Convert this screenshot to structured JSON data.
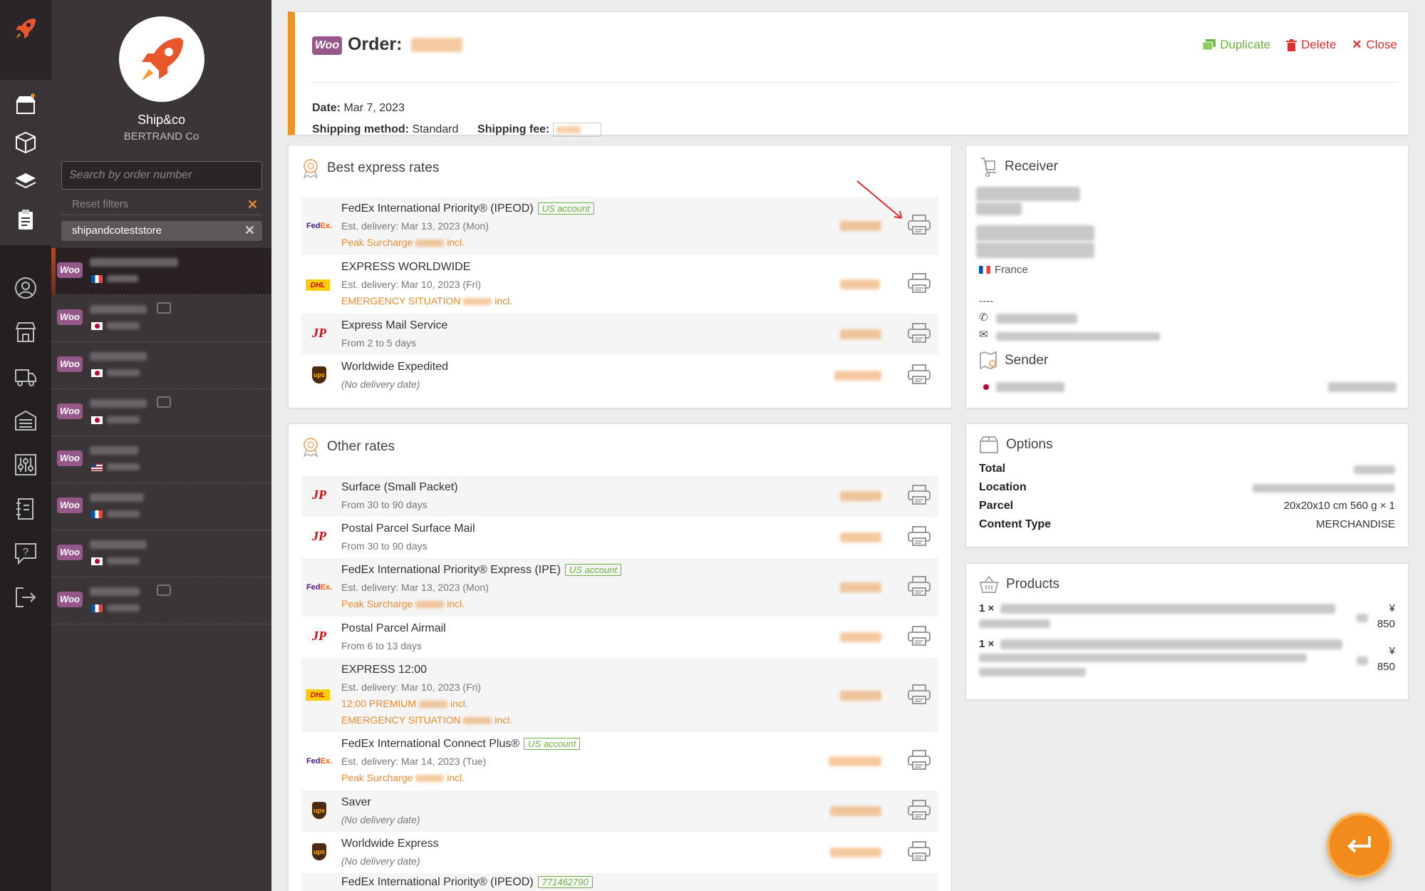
{
  "brand": {
    "name": "Ship&co",
    "company": "BERTRAND Co"
  },
  "sidebar": {
    "search_placeholder": "Search by order number",
    "reset_filters": "Reset filters",
    "filter_chip": "shipandcoteststore",
    "orders": [
      {
        "badge": "Woo",
        "flag": "fr",
        "active": true
      },
      {
        "badge": "Woo",
        "flag": "jp",
        "comment": true
      },
      {
        "badge": "Woo",
        "flag": "jp"
      },
      {
        "badge": "Woo",
        "flag": "jp",
        "comment": true
      },
      {
        "badge": "Woo",
        "flag": "us"
      },
      {
        "badge": "Woo",
        "flag": "fr"
      },
      {
        "badge": "Woo",
        "flag": "jp"
      },
      {
        "badge": "Woo",
        "flag": "fr",
        "comment": true
      }
    ]
  },
  "order": {
    "woo": "Woo",
    "title": "Order:",
    "date_label": "Date:",
    "date_value": "Mar 7, 2023",
    "method_label": "Shipping method:",
    "method_value": "Standard",
    "fee_label": "Shipping fee:",
    "actions": {
      "duplicate": "Duplicate",
      "delete": "Delete",
      "close": "Close"
    }
  },
  "best_rates": {
    "title": "Best express rates",
    "rows": [
      {
        "carrier": "fedex",
        "name": "FedEx International Priority® (IPEOD)",
        "badge": "US account",
        "sub": "Est. delivery: Mar 13, 2023 (Mon)",
        "warn": [
          "Peak Surcharge",
          "incl."
        ]
      },
      {
        "carrier": "dhl",
        "name": "EXPRESS WORLDWIDE",
        "sub": "Est. delivery: Mar 10, 2023 (Fri)",
        "warn": [
          "EMERGENCY SITUATION",
          "incl."
        ]
      },
      {
        "carrier": "jp",
        "name": "Express Mail Service",
        "sub": "From 2 to 5 days"
      },
      {
        "carrier": "ups",
        "name": "Worldwide Expedited",
        "sub": "(No delivery date)"
      }
    ]
  },
  "other_rates": {
    "title": "Other rates",
    "rows": [
      {
        "carrier": "jp",
        "name": "Surface (Small Packet)",
        "sub": "From 30 to 90 days"
      },
      {
        "carrier": "jp",
        "name": "Postal Parcel Surface Mail",
        "sub": "From 30 to 90 days"
      },
      {
        "carrier": "fedex",
        "name": "FedEx International Priority® Express (IPE)",
        "badge": "US account",
        "sub": "Est. delivery: Mar 13, 2023 (Mon)",
        "warn": [
          "Peak Surcharge",
          "incl."
        ]
      },
      {
        "carrier": "jp",
        "name": "Postal Parcel Airmail",
        "sub": "From 6 to 13 days"
      },
      {
        "carrier": "dhl",
        "name": "EXPRESS 12:00",
        "sub": "Est. delivery: Mar 10, 2023 (Fri)",
        "warn": [
          "12:00 PREMIUM",
          "incl."
        ],
        "warn2": [
          "EMERGENCY SITUATION",
          "incl."
        ]
      },
      {
        "carrier": "fedex",
        "name": "FedEx International Connect Plus®",
        "badge": "US account",
        "sub": "Est. delivery: Mar 14, 2023 (Tue)",
        "warn": [
          "Peak Surcharge",
          "incl."
        ]
      },
      {
        "carrier": "ups",
        "name": "Saver",
        "sub": "(No delivery date)"
      },
      {
        "carrier": "ups",
        "name": "Worldwide Express",
        "sub": "(No delivery date)"
      },
      {
        "carrier": "fedex",
        "name": "FedEx International Priority® (IPEOD)",
        "badge": "771462790"
      }
    ]
  },
  "receiver": {
    "title": "Receiver",
    "country": "France",
    "dashes": "----",
    "sender_title": "Sender"
  },
  "options": {
    "title": "Options",
    "rows": [
      {
        "key": "Total",
        "value": ""
      },
      {
        "key": "Location",
        "value": ""
      },
      {
        "key": "Parcel",
        "value": "20x20x10 cm 560 g × 1"
      },
      {
        "key": "Content Type",
        "value": "MERCHANDISE"
      }
    ]
  },
  "products": {
    "title": "Products",
    "items": [
      {
        "qty": "1 ×",
        "currency": "¥",
        "price": "850"
      },
      {
        "qty": "1 ×",
        "currency": "¥",
        "price": "850"
      }
    ]
  },
  "colors": {
    "accent": "#f0941e",
    "woo": "#96588a",
    "success": "#6cb33f",
    "danger": "#e52b2b"
  }
}
